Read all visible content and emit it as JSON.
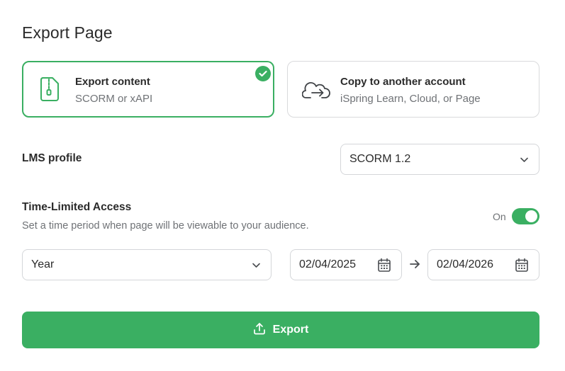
{
  "page": {
    "title": "Export Page"
  },
  "options": [
    {
      "title": "Export content",
      "subtitle": "SCORM or xAPI",
      "icon": "zip-file-icon",
      "selected": true
    },
    {
      "title": "Copy to another account",
      "subtitle": "iSpring Learn, Cloud, or Page",
      "icon": "cloud-transfer-icon",
      "selected": false
    }
  ],
  "lms": {
    "label": "LMS profile",
    "value": "SCORM 1.2"
  },
  "time_limited": {
    "title": "Time-Limited Access",
    "description": "Set a time period when page will be viewable to your audience.",
    "toggle_label": "On",
    "enabled": true,
    "period": "Year",
    "start_date": "02/04/2025",
    "end_date": "02/04/2026"
  },
  "export_button": {
    "label": "Export",
    "icon": "upload-icon"
  },
  "colors": {
    "accent": "#3aaf62",
    "border": "#d4d6d9",
    "muted_text": "#6f7276",
    "text": "#2b2b2b"
  }
}
